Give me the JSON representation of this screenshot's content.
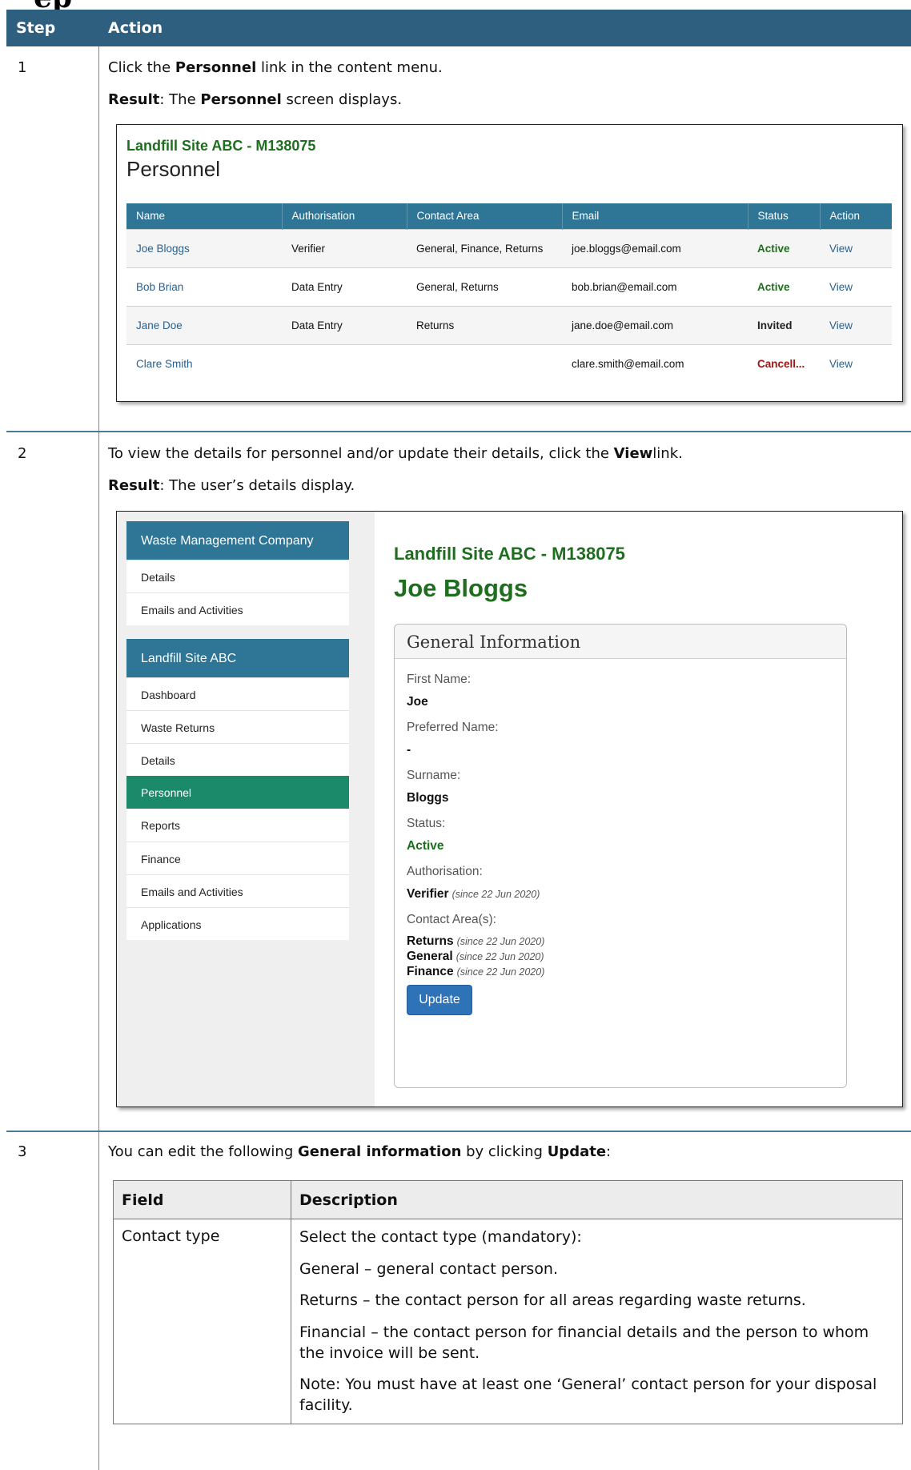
{
  "heading_fragment": "ep",
  "steps_table": {
    "header_step": "Step",
    "header_action": "Action"
  },
  "step1": {
    "num": "1",
    "instruction": {
      "pre": "Click the ",
      "bold": "Personnel",
      "post": " link in the content menu."
    },
    "result": {
      "label": "Result",
      "pre": ": The ",
      "bold": "Personnel",
      "post": " screen displays."
    },
    "screen": {
      "site": "Landfill Site ABC - M138075",
      "title": "Personnel",
      "columns": [
        "Name",
        "Authorisation",
        "Contact Area",
        "Email",
        "Status",
        "Action"
      ],
      "rows": [
        {
          "name": "Joe Bloggs",
          "auth": "Verifier",
          "area": "General, Finance, Returns",
          "email": "joe.bloggs@email.com",
          "status": "Active",
          "action": "View"
        },
        {
          "name": "Bob Brian",
          "auth": "Data Entry",
          "area": "General, Returns",
          "email": "bob.brian@email.com",
          "status": "Active",
          "action": "View"
        },
        {
          "name": "Jane Doe",
          "auth": "Data Entry",
          "area": "Returns",
          "email": "jane.doe@email.com",
          "status": "Invited",
          "action": "View"
        },
        {
          "name": "Clare Smith",
          "auth": "",
          "area": "",
          "email": "clare.smith@email.com",
          "status": "Cancell...",
          "action": "View"
        }
      ]
    }
  },
  "step2": {
    "num": "2",
    "instruction": {
      "pre": "To view the details for personnel and/or update their details, click the ",
      "bold": "View",
      "post": "link."
    },
    "result": {
      "label": "Result",
      "post": ": The user’s details display."
    },
    "screen": {
      "company_box": {
        "title": "Waste Management Company",
        "items": [
          "Details",
          "Emails and Activities"
        ]
      },
      "site_box": {
        "title": "Landfill Site ABC",
        "items": [
          "Dashboard",
          "Waste Returns",
          "Details",
          "Personnel",
          "Reports",
          "Finance",
          "Emails and Activities",
          "Applications"
        ],
        "active": "Personnel"
      },
      "site": "Landfill Site ABC - M138075",
      "person": "Joe Bloggs",
      "panel_title": "General Information",
      "first_name_label": "First Name:",
      "first_name": "Joe",
      "preferred_label": "Preferred Name:",
      "preferred": "-",
      "surname_label": "Surname:",
      "surname": "Bloggs",
      "status_label": "Status:",
      "status": "Active",
      "auth_label": "Authorisation:",
      "auth_value": "Verifier",
      "auth_since": "(since 22 Jun 2020)",
      "contact_label": "Contact Area(s):",
      "contacts": [
        {
          "name": "Returns",
          "since": "(since 22 Jun 2020)"
        },
        {
          "name": "General",
          "since": "(since 22 Jun 2020)"
        },
        {
          "name": "Finance",
          "since": "(since 22 Jun 2020)"
        }
      ],
      "update_label": "Update"
    }
  },
  "step3": {
    "num": "3",
    "instruction": {
      "pre": "You can edit the following ",
      "bold": "General information",
      "mid": " by clicking ",
      "bold2": "Update",
      "post": ":"
    },
    "table": {
      "col_field": "Field",
      "col_desc": "Description",
      "field": "Contact type",
      "desc": [
        "Select the contact type (mandatory):",
        "General – general contact person.",
        "Returns – the contact person for all areas regarding waste returns.",
        "Financial – the contact person for financial details and the person to whom the invoice will be sent.",
        "Note: You must have at least one ‘General’ contact person for your disposal facility."
      ]
    }
  }
}
